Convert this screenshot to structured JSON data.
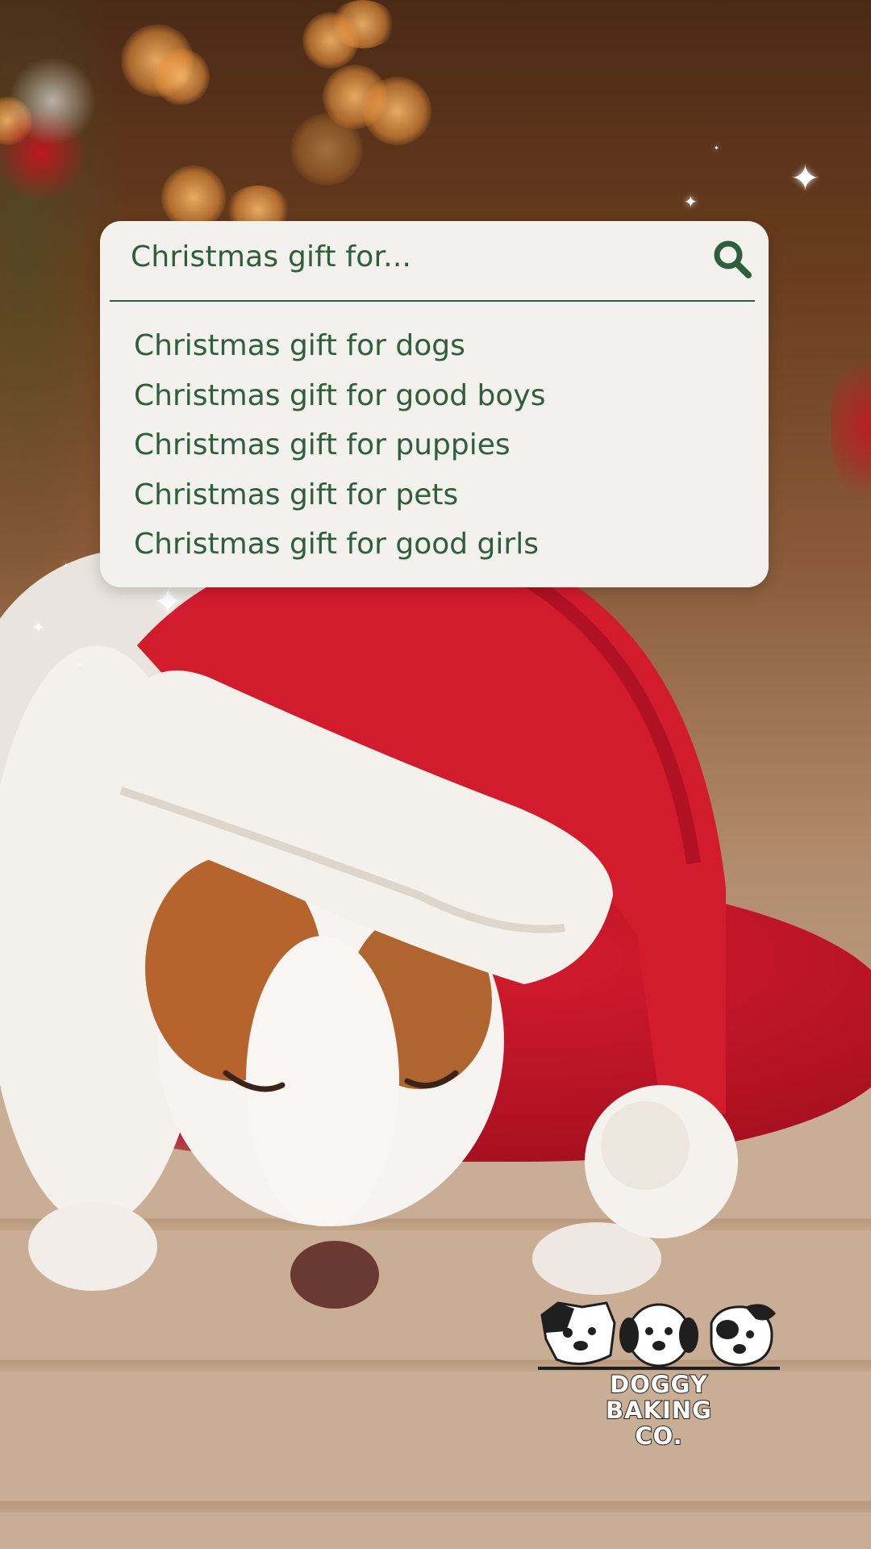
{
  "search": {
    "query": "Christmas gift for...",
    "suggestions": [
      "Christmas gift for dogs",
      "Christmas gift for good boys",
      "Christmas gift for puppies",
      "Christmas gift for pets",
      "Christmas gift for good girls"
    ]
  },
  "logo": {
    "line1": "DOGGY",
    "line2": "BAKING",
    "line3": "CO."
  },
  "colors": {
    "accent_green": "#2f5e3c",
    "card_background": "#f3f1ed",
    "hat_red": "#d31b2e"
  },
  "icons": [
    "search-icon",
    "sparkle-icon",
    "dog-logo-icon"
  ]
}
